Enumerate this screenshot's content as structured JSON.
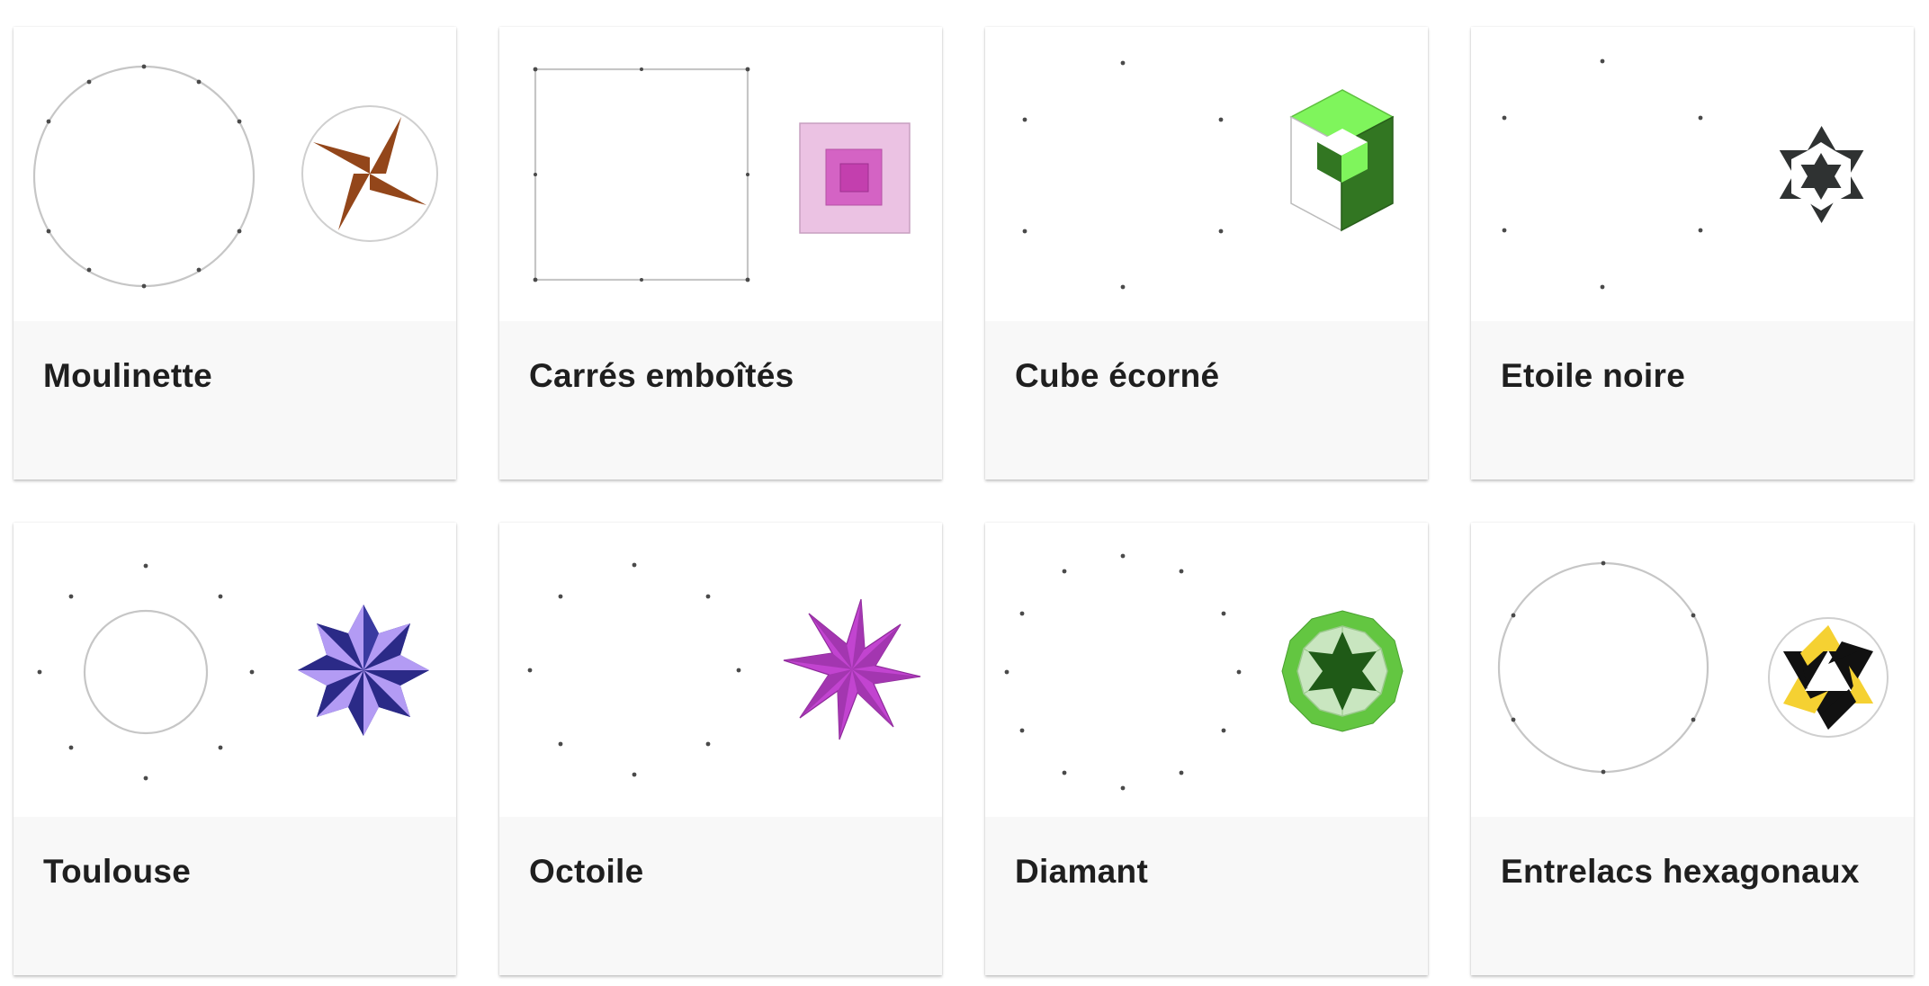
{
  "gallery": {
    "cards": [
      {
        "title": "Moulinette",
        "colors": {
          "primary": "#93461a"
        }
      },
      {
        "title": "Carrés emboîtés",
        "colors": {
          "outer": "#ebc2e3",
          "middle": "#d463c4",
          "inner": "#c33fae"
        }
      },
      {
        "title": "Cube écorné",
        "colors": {
          "light": "#7ff55c",
          "dark": "#327622"
        }
      },
      {
        "title": "Etoile noire",
        "colors": {
          "primary": "#2f3232"
        }
      },
      {
        "title": "Toulouse",
        "colors": {
          "light": "#b39bf4",
          "dark": "#2b2a87"
        }
      },
      {
        "title": "Octoile",
        "colors": {
          "primary": "#c244d0"
        }
      },
      {
        "title": "Diamant",
        "colors": {
          "light": "#63c641",
          "dark": "#1f5a17",
          "pale": "#c9e6c0"
        }
      },
      {
        "title": "Entrelacs hexagonaux",
        "colors": {
          "gold": "#f5d132",
          "dark": "#111111"
        }
      }
    ]
  }
}
